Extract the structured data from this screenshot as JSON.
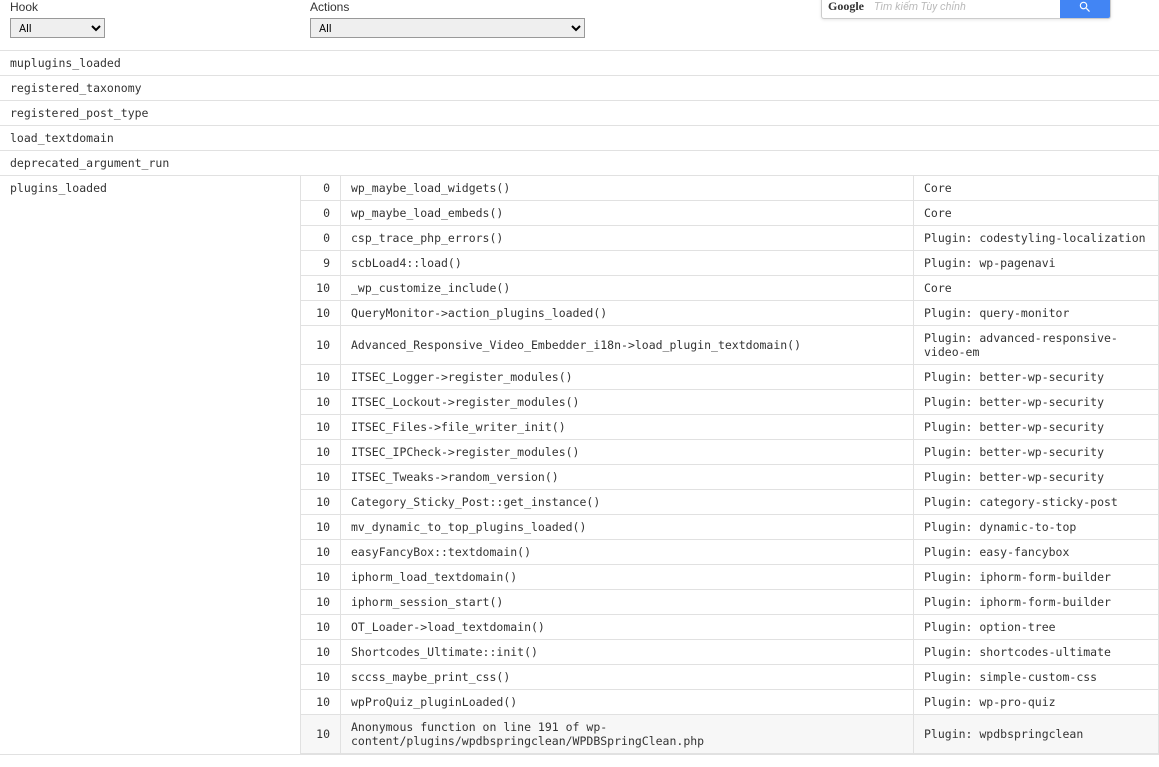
{
  "filters": {
    "hook_label": "Hook",
    "hook_value": "All",
    "actions_label": "Actions",
    "actions_value": "All"
  },
  "search": {
    "logo": "Google",
    "placeholder": "Tìm kiếm Tùy chỉnh"
  },
  "hooks": [
    {
      "name": "muplugins_loaded",
      "actions": []
    },
    {
      "name": "registered_taxonomy",
      "actions": []
    },
    {
      "name": "registered_post_type",
      "actions": []
    },
    {
      "name": "load_textdomain",
      "actions": []
    },
    {
      "name": "deprecated_argument_run",
      "actions": []
    },
    {
      "name": "plugins_loaded",
      "actions": [
        {
          "priority": "0",
          "callback": "wp_maybe_load_widgets()",
          "source": "Core"
        },
        {
          "priority": "0",
          "callback": "wp_maybe_load_embeds()",
          "source": "Core"
        },
        {
          "priority": "0",
          "callback": "csp_trace_php_errors()",
          "source": "Plugin: codestyling-localization"
        },
        {
          "priority": "9",
          "callback": "scbLoad4::load()",
          "source": "Plugin: wp-pagenavi"
        },
        {
          "priority": "10",
          "callback": "_wp_customize_include()",
          "source": "Core"
        },
        {
          "priority": "10",
          "callback": "QueryMonitor->action_plugins_loaded()",
          "source": "Plugin: query-monitor"
        },
        {
          "priority": "10",
          "callback": "Advanced_Responsive_Video_Embedder_i18n->load_plugin_textdomain()",
          "source": "Plugin: advanced-responsive-video-em"
        },
        {
          "priority": "10",
          "callback": "ITSEC_Logger->register_modules()",
          "source": "Plugin: better-wp-security"
        },
        {
          "priority": "10",
          "callback": "ITSEC_Lockout->register_modules()",
          "source": "Plugin: better-wp-security"
        },
        {
          "priority": "10",
          "callback": "ITSEC_Files->file_writer_init()",
          "source": "Plugin: better-wp-security"
        },
        {
          "priority": "10",
          "callback": "ITSEC_IPCheck->register_modules()",
          "source": "Plugin: better-wp-security"
        },
        {
          "priority": "10",
          "callback": "ITSEC_Tweaks->random_version()",
          "source": "Plugin: better-wp-security"
        },
        {
          "priority": "10",
          "callback": "Category_Sticky_Post::get_instance()",
          "source": "Plugin: category-sticky-post"
        },
        {
          "priority": "10",
          "callback": "mv_dynamic_to_top_plugins_loaded()",
          "source": "Plugin: dynamic-to-top"
        },
        {
          "priority": "10",
          "callback": "easyFancyBox::textdomain()",
          "source": "Plugin: easy-fancybox"
        },
        {
          "priority": "10",
          "callback": "iphorm_load_textdomain()",
          "source": "Plugin: iphorm-form-builder"
        },
        {
          "priority": "10",
          "callback": "iphorm_session_start()",
          "source": "Plugin: iphorm-form-builder"
        },
        {
          "priority": "10",
          "callback": "OT_Loader->load_textdomain()",
          "source": "Plugin: option-tree"
        },
        {
          "priority": "10",
          "callback": "Shortcodes_Ultimate::init()",
          "source": "Plugin: shortcodes-ultimate"
        },
        {
          "priority": "10",
          "callback": "sccss_maybe_print_css()",
          "source": "Plugin: simple-custom-css"
        },
        {
          "priority": "10",
          "callback": "wpProQuiz_pluginLoaded()",
          "source": "Plugin: wp-pro-quiz"
        },
        {
          "priority": "10",
          "callback": "Anonymous function on line 191 of wp-content/plugins/wpdbspringclean/WPDBSpringClean.php",
          "source": "Plugin: wpdbspringclean",
          "highlight": true
        }
      ]
    }
  ]
}
